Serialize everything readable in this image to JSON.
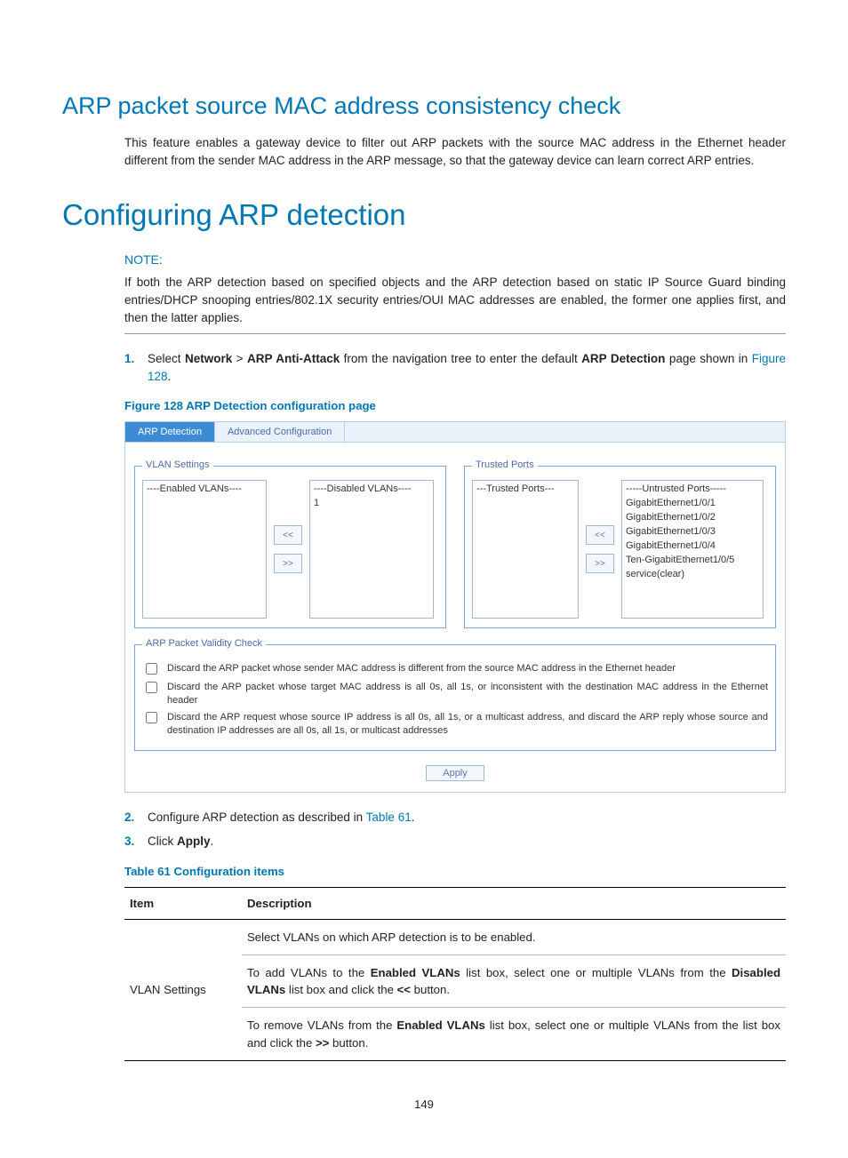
{
  "section1": {
    "title": "ARP packet source MAC address consistency check",
    "body": "This feature enables a gateway device to filter out ARP packets with the source MAC address in the Ethernet header different from the sender MAC address in the ARP message, so that the gateway device can learn correct ARP entries."
  },
  "section2": {
    "title": "Configuring ARP detection",
    "note_label": "NOTE:",
    "note_body": "If both the ARP detection based on specified objects and the ARP detection based on static IP Source Guard binding entries/DHCP snooping entries/802.1X security entries/OUI MAC addresses are enabled, the former one applies first, and then the latter applies."
  },
  "steps": {
    "s1_num": "1.",
    "s1_pre": "Select ",
    "s1_b1": "Network",
    "s1_gt": " > ",
    "s1_b2": "ARP Anti-Attack",
    "s1_mid": " from the navigation tree to enter the default ",
    "s1_b3": "ARP Detection",
    "s1_post": " page shown in ",
    "s1_link": "Figure 128",
    "s1_end": ".",
    "s2_num": "2.",
    "s2_pre": "Configure ARP detection as described in ",
    "s2_link": "Table 61",
    "s2_end": ".",
    "s3_num": "3.",
    "s3_pre": "Click ",
    "s3_b1": "Apply",
    "s3_end": "."
  },
  "figure": {
    "caption": "Figure 128 ARP Detection configuration page",
    "tab_active": "ARP Detection",
    "tab_other": "Advanced Configuration",
    "vlan_legend": "VLAN Settings",
    "enabled_header": "----Enabled VLANs----",
    "disabled_header": "----Disabled VLANs----",
    "disabled_items": [
      "1"
    ],
    "trusted_legend": "Trusted Ports",
    "trusted_header": "---Trusted Ports---",
    "untrusted_header": "-----Untrusted Ports-----",
    "untrusted_items": [
      "GigabitEthernet1/0/1",
      "GigabitEthernet1/0/2",
      "GigabitEthernet1/0/3",
      "GigabitEthernet1/0/4",
      "Ten-GigabitEthernet1/0/5",
      "service(clear)"
    ],
    "btn_left": "<<",
    "btn_right": ">>",
    "validity_legend": "ARP Packet Validity Check",
    "chk1": "Discard the ARP packet whose sender MAC address is different from the source MAC address in the Ethernet header",
    "chk2": "Discard the ARP packet whose target MAC address is all 0s, all 1s, or inconsistent with the destination MAC address in the Ethernet header",
    "chk3": "Discard the ARP request whose source IP address is all 0s, all 1s, or a multicast address, and discard the ARP reply whose source and destination IP addresses are all 0s, all 1s, or multicast addresses",
    "apply": "Apply"
  },
  "table": {
    "caption": "Table 61 Configuration items",
    "h1": "Item",
    "h2": "Description",
    "row1_item": "VLAN Settings",
    "row1_d1": "Select VLANs on which ARP detection is to be enabled.",
    "row1_d2_a": "To add VLANs to the ",
    "row1_d2_b1": "Enabled VLANs",
    "row1_d2_b": " list box, select one or multiple VLANs from the ",
    "row1_d2_b2": "Disabled VLANs",
    "row1_d2_c": " list box and click the ",
    "row1_d2_b3": "<<",
    "row1_d2_d": " button.",
    "row1_d3_a": "To remove VLANs from the ",
    "row1_d3_b1": "Enabled VLANs",
    "row1_d3_b": " list box, select one or multiple VLANs from the list box and click the ",
    "row1_d3_b2": ">>",
    "row1_d3_c": " button."
  },
  "page_number": "149"
}
